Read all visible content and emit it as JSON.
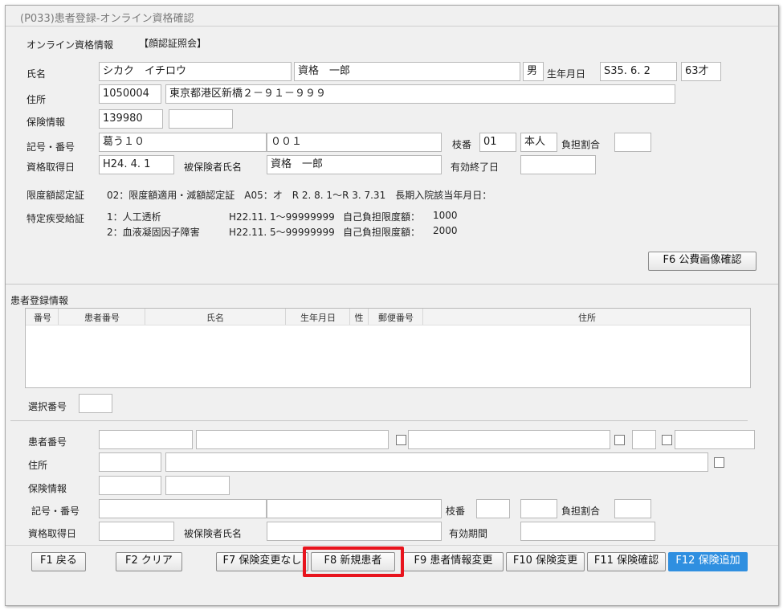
{
  "window": {
    "title": "(P033)患者登録-オンライン資格確認"
  },
  "online": {
    "section_label": "オンライン資格情報",
    "mode": "【顔認証照会】",
    "labels": {
      "name": "氏名",
      "birth": "生年月日",
      "address": "住所",
      "insurance": "保険情報",
      "kigo_bango": "記号・番号",
      "edaban": "枝番",
      "burden_ratio": "負担割合",
      "qualified_date": "資格取得日",
      "insured_name": "被保険者氏名",
      "valid_until": "有効終了日",
      "limit_cert": "限度額認定証",
      "specific_disease": "特定疾受給証"
    },
    "name_kana": "シカク　イチロウ",
    "name_kanji": "資格　一郎",
    "sex": "男",
    "birth": "S35. 6. 2",
    "age": "63才",
    "postal": "1050004",
    "address": "東京都港区新橋２－９１－９９９",
    "insurer_no": "139980",
    "insurer_extra": "",
    "kigo": "葛う１０",
    "bango": "００１",
    "edaban": "01",
    "relation": "本人",
    "burden_ratio": "",
    "qualified_date": "H24. 4. 1",
    "insured_name": "資格　一郎",
    "valid_until": "",
    "limit_cert_text": "02：限度額適用・減額認定証　A05：オ　R 2. 8. 1～R 3. 7.31　長期入院該当年月日：",
    "disease_rows": [
      {
        "name": "1：人工透析",
        "period": "H22.11. 1～99999999",
        "limit_label": "自己負担限度額：",
        "limit": "1000"
      },
      {
        "name": "2：血液凝固因子障害",
        "period": "H22.11. 5～99999999",
        "limit_label": "自己負担限度額：",
        "limit": "2000"
      }
    ],
    "f6_button": "F6 公費画像確認"
  },
  "patient": {
    "section_label": "患者登録情報",
    "columns": [
      "番号",
      "患者番号",
      "氏名",
      "生年月日",
      "性",
      "郵便番号",
      "住所"
    ],
    "select_label": "選択番号",
    "select_value": "",
    "labels": {
      "patient_no": "患者番号",
      "address": "住所",
      "insurance": "保険情報",
      "kigo_bango": "記号・番号",
      "edaban": "枝番",
      "burden_ratio": "負担割合",
      "qualified_date": "資格取得日",
      "insured_name": "被保険者氏名",
      "valid_period": "有効期間"
    }
  },
  "footer": {
    "f1": "F1 戻る",
    "f2": "F2 クリア",
    "f7": "F7 保険変更なし",
    "f8": "F8 新規患者",
    "f9": "F9 患者情報変更",
    "f10": "F10 保険変更",
    "f11": "F11 保険確認",
    "f12": "F12 保険追加"
  },
  "colors": {
    "accent": "#2f8fe0",
    "highlight": "#e8141d"
  }
}
